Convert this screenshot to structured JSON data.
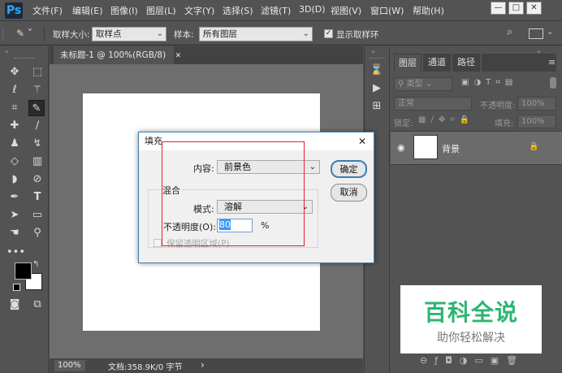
{
  "app": {
    "logo": "Ps"
  },
  "menu": [
    "文件(F)",
    "编辑(E)",
    "图像(I)",
    "图层(L)",
    "文字(Y)",
    "选择(S)",
    "滤镜(T)",
    "3D(D)",
    "视图(V)",
    "窗口(W)",
    "帮助(H)"
  ],
  "window_controls": {
    "minimize": "—",
    "maximize": "□",
    "close": "✕"
  },
  "options": {
    "sample_size_label": "取样大小:",
    "sample_size_value": "取样点",
    "sample_label": "样本:",
    "sample_value": "所有图层",
    "show_ring_label": "显示取样环",
    "show_ring_checked": true
  },
  "document": {
    "tab_title": "未标题-1 @ 100%(RGB/8)",
    "tab_close": "✕"
  },
  "status": {
    "zoom": "100%",
    "doc_info": "文档:358.9K/0 字节",
    "arrow": "›"
  },
  "panel": {
    "tabs": [
      "图层",
      "通道",
      "路径"
    ],
    "kind_filter": "类型",
    "blend_mode": "正常",
    "opacity_label": "不透明度:",
    "opacity_value": "100%",
    "lock_label": "锁定:",
    "fill_label": "填充:",
    "fill_value": "100%",
    "layer_name": "背景"
  },
  "dialog": {
    "title": "填充",
    "close": "✕",
    "content_label": "内容:",
    "content_value": "前景色",
    "ok": "确定",
    "cancel": "取消",
    "blend_group": "混合",
    "mode_label": "模式:",
    "mode_value": "溶解",
    "opacity_label": "不透明度(O):",
    "opacity_value": "80",
    "opacity_unit": "%",
    "preserve_label": "保留透明区域(P)"
  },
  "watermark": {
    "title": "百科全说",
    "subtitle": "助你轻松解决"
  },
  "colors": {
    "ps_blue": "#31a8ff",
    "highlight_red": "#e0242b",
    "watermark_green": "#2bb673",
    "dialog_border": "#3c7fb1"
  }
}
